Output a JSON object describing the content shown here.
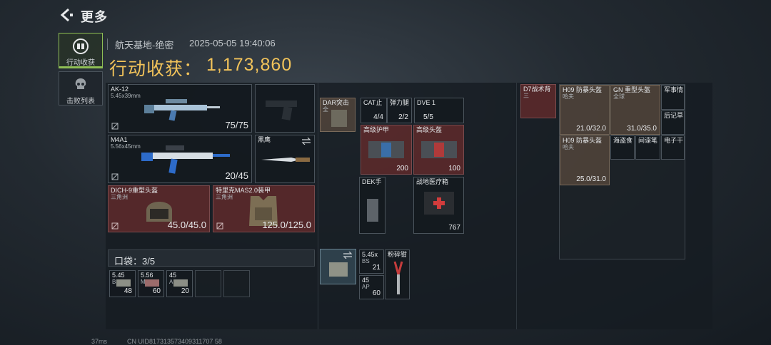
{
  "header": {
    "title": "更多"
  },
  "nav": {
    "loot_label": "行动收获",
    "kills_label": "击败列表"
  },
  "meta": {
    "map": "航天基地-绝密",
    "datetime": "2025-05-05 19:40:06",
    "gain_label": "行动收获：",
    "gain_value": "1,173,860"
  },
  "weapons": {
    "primary": {
      "name": "AK-12",
      "caliber": "5.45x39mm",
      "durability": "75/75"
    },
    "secondary": {
      "name": "M4A1",
      "caliber": "5.56x45mm",
      "durability": "20/45"
    },
    "melee": {
      "name": "黑鹰"
    }
  },
  "gear": {
    "helmet": {
      "name": "DICH-9重型头盔",
      "origin": "三角洲",
      "durability": "45.0/45.0"
    },
    "armor": {
      "name": "特里克MAS2.0装甲",
      "origin": "三角洲",
      "durability": "125.0/125.0"
    }
  },
  "pocket": {
    "label": "口袋：3/5",
    "items": [
      {
        "name": "5.45",
        "sub": "BS",
        "count": "48"
      },
      {
        "name": "5.56",
        "sub": "M8S",
        "count": "60"
      },
      {
        "name": "45",
        "sub": "AP",
        "count": "20"
      }
    ]
  },
  "rig": {
    "items": [
      {
        "name": "DAR突击",
        "sub": "全",
        "count": ""
      },
      {
        "name": "CAT止",
        "sub": "",
        "count": "4/4"
      },
      {
        "name": "弹力腿",
        "sub": "",
        "count": "2/2"
      },
      {
        "name": "DVE 1",
        "sub": "",
        "count": "5/5"
      },
      {
        "name": "高级护甲",
        "sub": "",
        "count": "200"
      },
      {
        "name": "高级头盔",
        "sub": "",
        "count": "100"
      },
      {
        "name": "DEK手",
        "sub": "",
        "count": ""
      },
      {
        "name": "战地医疗箱",
        "sub": "",
        "count": "767"
      }
    ]
  },
  "backpack": {
    "items": [
      {
        "name": "5.45x",
        "sub": "BS",
        "count": "21"
      },
      {
        "name": "粉碎钳",
        "sub": "",
        "count": ""
      },
      {
        "name": "45",
        "sub": "AP",
        "count": "60"
      }
    ]
  },
  "container": {
    "items": [
      {
        "name": "D7战术背",
        "sub": "三",
        "count": ""
      },
      {
        "name": "H09 防暴头盔",
        "sub": "哈夫",
        "count": "21.0/32.0"
      },
      {
        "name": "GN 重型头盔",
        "sub": "全球",
        "count": "31.0/35.0"
      },
      {
        "name": "军事情",
        "sub": "",
        "count": ""
      },
      {
        "name": "后记草",
        "sub": "",
        "count": ""
      },
      {
        "name": "H09 防暴头盔",
        "sub": "哈夫",
        "count": "25.0/31.0"
      },
      {
        "name": "海盗食",
        "sub": "",
        "count": ""
      },
      {
        "name": "间谍笔",
        "sub": "",
        "count": ""
      },
      {
        "name": "电子干",
        "sub": "",
        "count": ""
      }
    ]
  },
  "footer": {
    "ping": "37ms",
    "uid": "CN UID817313573409311707 58"
  },
  "colors": {
    "accent_gold": "#f2c35a",
    "accent_green": "#8fbf55",
    "slot_red": "#5f2a2c"
  }
}
